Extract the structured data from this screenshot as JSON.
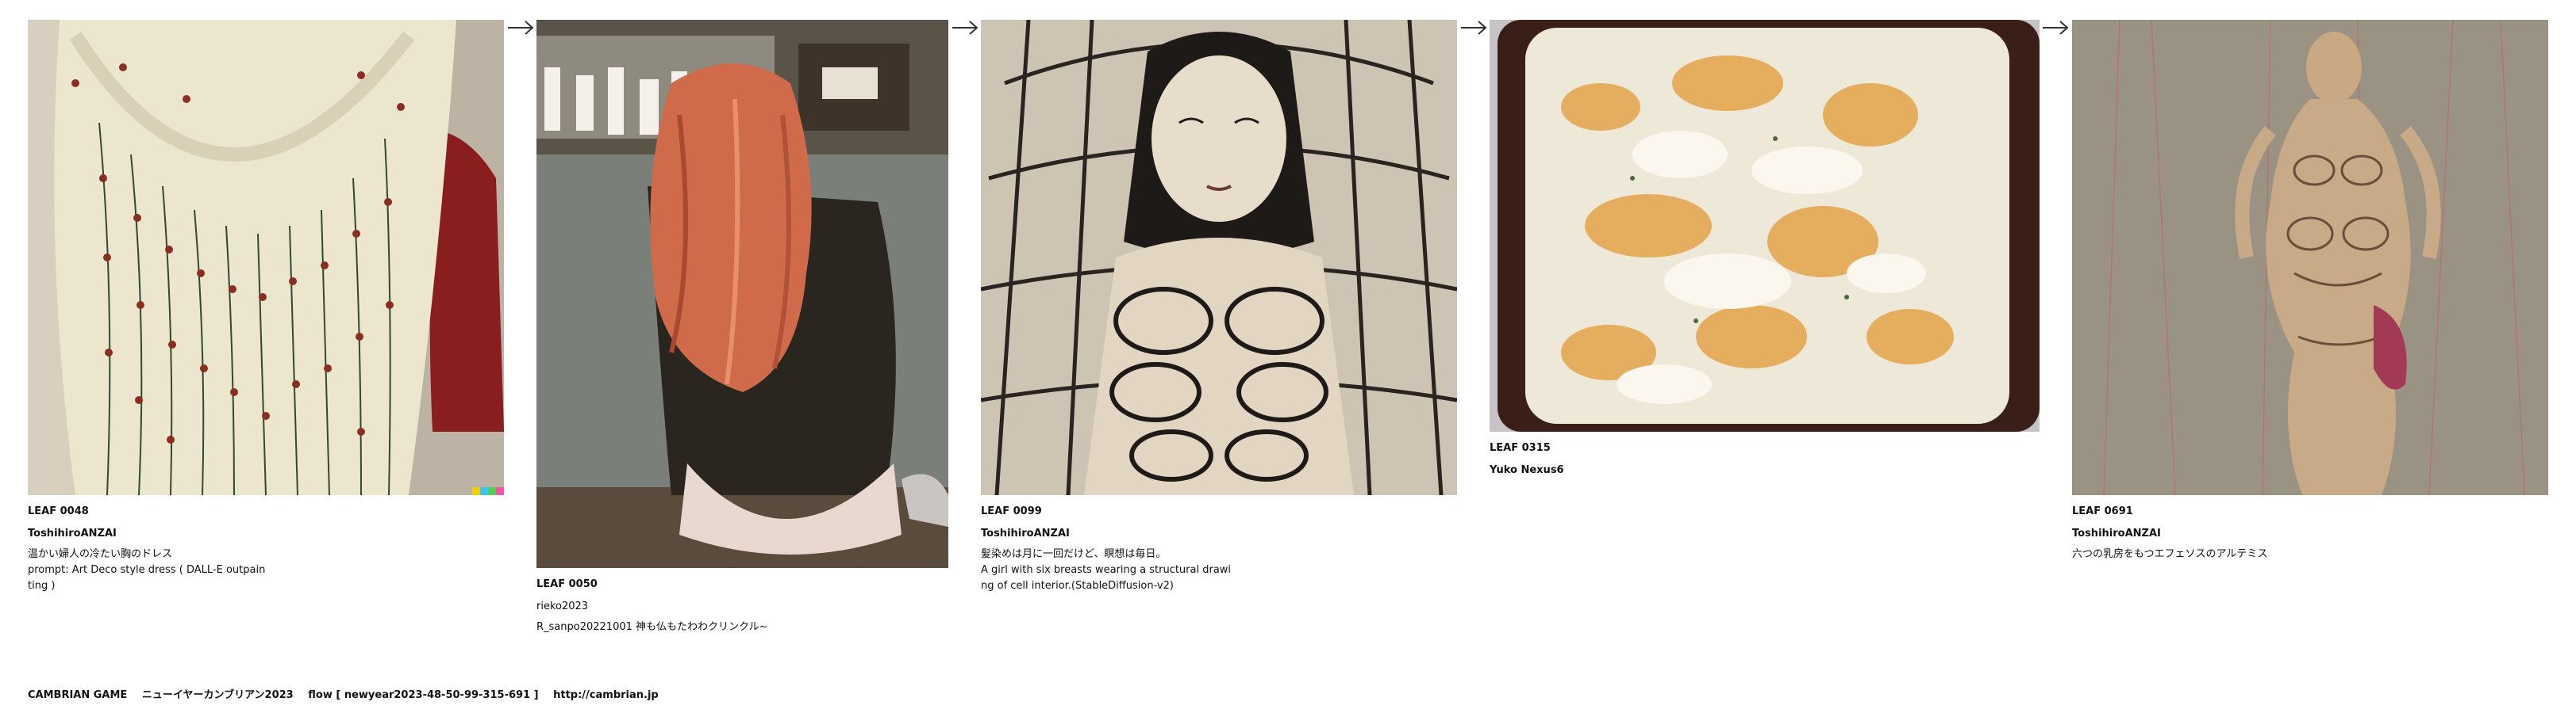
{
  "leaves": [
    {
      "title": "LEAF 0048",
      "author": "ToshihiroANZAI",
      "desc": "温かい婦人の冷たい胸のドレス\nprompt: Art Deco style dress ( DALL-E outpain\nting )",
      "image_icon": "ceramic-dress-image"
    },
    {
      "title": "LEAF 0050",
      "author": "rieko2023",
      "desc": "R_sanpo20221001 神も仏もたわわクリンクル~",
      "image_icon": "red-hair-woman-image"
    },
    {
      "title": "LEAF 0099",
      "author": "ToshihiroANZAI",
      "desc": "髪染めは月に一回だけど、瞑想は毎日。\nA girl with six breasts wearing a structural drawi\nng of cell interior.(StableDiffusion-v2)",
      "image_icon": "structural-drawing-image"
    },
    {
      "title": "LEAF 0315",
      "author": "Yuko Nexus6",
      "desc": "",
      "image_icon": "gratin-dish-image"
    },
    {
      "title": "LEAF 0691",
      "author": "ToshihiroANZAI",
      "desc": "六つの乳房をもつエフェソスのアルテミス",
      "image_icon": "artemis-figure-image"
    }
  ],
  "footer": {
    "game": "CAMBRIAN GAME",
    "name": "ニューイヤーカンブリアン2023",
    "flow": "flow [ newyear2023-48-50-99-315-691 ]",
    "url": "http://cambrian.jp"
  },
  "colors": {
    "text": "#111111",
    "arrow": "#333333"
  }
}
